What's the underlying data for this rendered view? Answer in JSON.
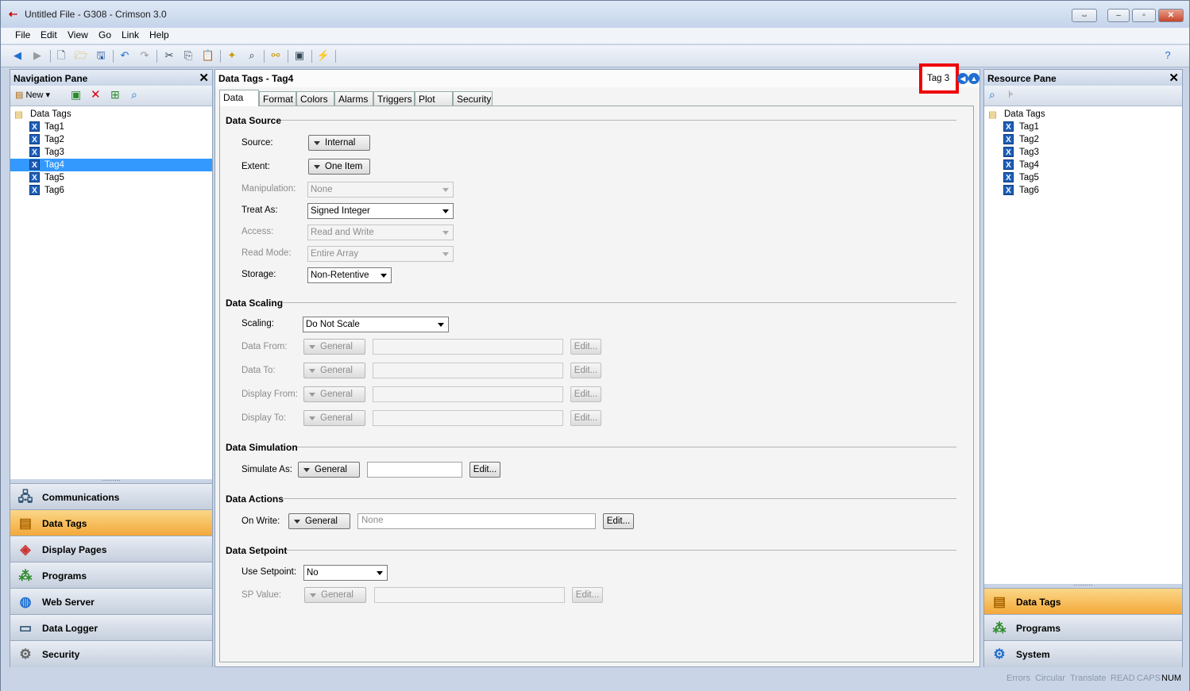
{
  "window": {
    "title": "Untitled File - G308 - Crimson 3.0"
  },
  "menu": [
    "File",
    "Edit",
    "View",
    "Go",
    "Link",
    "Help"
  ],
  "nav": {
    "title": "Navigation Pane",
    "new_label": "New",
    "tree_root": "Data Tags",
    "tags": [
      "Tag1",
      "Tag2",
      "Tag3",
      "Tag4",
      "Tag5",
      "Tag6"
    ],
    "selected": "Tag4",
    "buttons": [
      "Communications",
      "Data Tags",
      "Display Pages",
      "Programs",
      "Web Server",
      "Data Logger",
      "Security"
    ]
  },
  "editor": {
    "title": "Data Tags - Tag4",
    "nav_tag": "Tag 3",
    "tabs": [
      "Data",
      "Format",
      "Colors",
      "Alarms",
      "Triggers",
      "Plot",
      "Security"
    ],
    "sections": {
      "source": "Data Source",
      "scaling": "Data Scaling",
      "simulation": "Data Simulation",
      "actions": "Data Actions",
      "setpoint": "Data Setpoint"
    },
    "labels": {
      "source": "Source:",
      "extent": "Extent:",
      "manipulation": "Manipulation:",
      "treat_as": "Treat As:",
      "access": "Access:",
      "read_mode": "Read Mode:",
      "storage": "Storage:",
      "scaling": "Scaling:",
      "data_from": "Data From:",
      "data_to": "Data To:",
      "display_from": "Display From:",
      "display_to": "Display To:",
      "simulate_as": "Simulate As:",
      "on_write": "On Write:",
      "use_setpoint": "Use Setpoint:",
      "sp_value": "SP Value:"
    },
    "values": {
      "source": "Internal",
      "extent": "One Item",
      "manipulation": "None",
      "treat_as": "Signed Integer",
      "access": "Read and Write",
      "read_mode": "Entire Array",
      "storage": "Non-Retentive",
      "scaling": "Do Not Scale",
      "general": "General",
      "on_write_placeholder": "None",
      "use_setpoint": "No"
    },
    "edit_label": "Edit..."
  },
  "resource": {
    "title": "Resource Pane",
    "tree_root": "Data Tags",
    "tags": [
      "Tag1",
      "Tag2",
      "Tag3",
      "Tag4",
      "Tag5",
      "Tag6"
    ],
    "buttons": [
      "Data Tags",
      "Programs",
      "System"
    ]
  },
  "status": [
    "Errors",
    "Circular",
    "Translate",
    "READ",
    "CAPS",
    "NUM"
  ]
}
